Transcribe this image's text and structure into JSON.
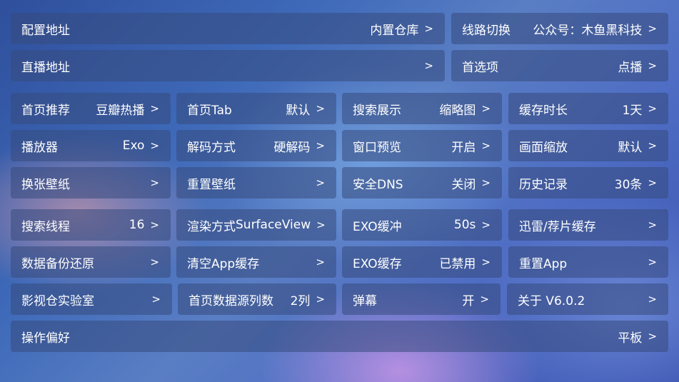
{
  "rows": [
    [
      {
        "label": "配置地址",
        "value": "内置仓库"
      },
      {
        "label": "线路切换",
        "value": "公众号：木鱼黑科技"
      }
    ],
    [
      {
        "label": "直播地址",
        "value": ""
      },
      {
        "label": "首选项",
        "value": "点播"
      }
    ],
    [
      {
        "label": "首页推荐",
        "value": "豆瓣热播"
      },
      {
        "label": "首页Tab",
        "value": "默认"
      },
      {
        "label": "搜索展示",
        "value": "缩略图"
      },
      {
        "label": "缓存时长",
        "value": "1天"
      }
    ],
    [
      {
        "label": "播放器",
        "value": "Exo"
      },
      {
        "label": "解码方式",
        "value": "硬解码"
      },
      {
        "label": "窗口预览",
        "value": "开启"
      },
      {
        "label": "画面缩放",
        "value": "默认"
      }
    ],
    [
      {
        "label": "换张壁纸",
        "value": ""
      },
      {
        "label": "重置壁纸",
        "value": ""
      },
      {
        "label": "安全DNS",
        "value": "关闭"
      },
      {
        "label": "历史记录",
        "value": "30条"
      }
    ],
    [
      {
        "label": "搜索线程",
        "value": "16"
      },
      {
        "label": "渲染方式",
        "value": "SurfaceView"
      },
      {
        "label": "EXO缓冲",
        "value": "50s"
      },
      {
        "label": "迅雷/荐片缓存",
        "value": ""
      }
    ],
    [
      {
        "label": "数据备份还原",
        "value": ""
      },
      {
        "label": "清空App缓存",
        "value": ""
      },
      {
        "label": "EXO缓存",
        "value": "已禁用"
      },
      {
        "label": "重置App",
        "value": ""
      }
    ],
    [
      {
        "label": "影视仓实验室",
        "value": ""
      },
      {
        "label": "首页数据源列数",
        "value": "2列"
      },
      {
        "label": "弹幕",
        "value": "开"
      },
      {
        "label": "关于  V6.0.2",
        "value": ""
      }
    ],
    [
      {
        "label": "操作偏好",
        "value": "平板"
      }
    ]
  ],
  "chevron": ">"
}
